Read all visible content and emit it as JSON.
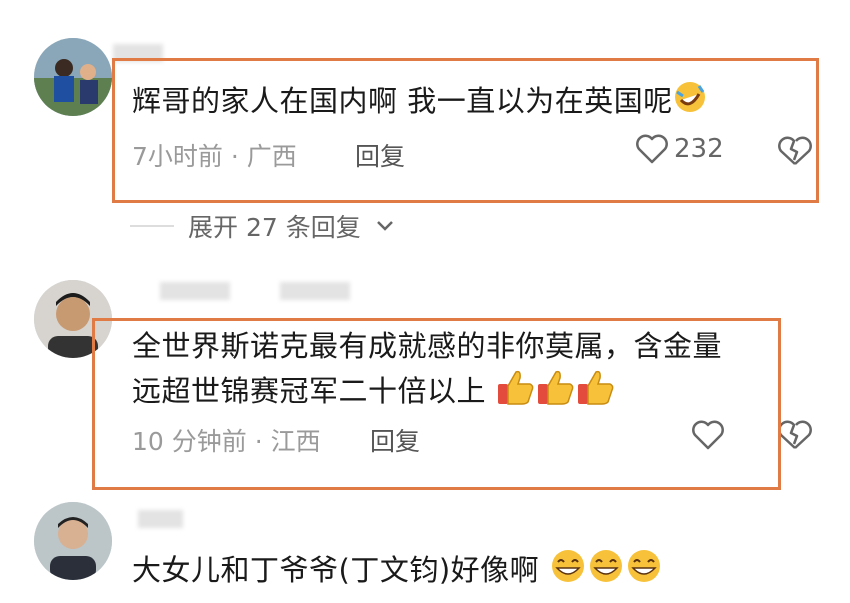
{
  "comments": [
    {
      "text": "辉哥的家人在国内啊 我一直以为在英国呢",
      "emojis": [
        "rofl-emoji"
      ],
      "time": "7小时前",
      "location": "广西",
      "meta": "7小时前 · 广西",
      "reply": "回复",
      "likes": "232"
    },
    {
      "line1": "全世界斯诺克最有成就感的非你莫属，含金量",
      "line2": "远超世锦赛冠军二十倍以上",
      "emojis": [
        "thumbs-up-emoji",
        "thumbs-up-emoji",
        "thumbs-up-emoji"
      ],
      "meta": "10 分钟前 · 江西",
      "reply": "回复"
    },
    {
      "text": "大女儿和丁爷爷(丁文钧)好像啊",
      "emojis": [
        "grin-emoji",
        "grin-emoji",
        "grin-emoji"
      ]
    }
  ],
  "expand_replies": "展开 27 条回复",
  "colors": {
    "highlight": "#e07b45",
    "meta": "#9a9a9a"
  }
}
